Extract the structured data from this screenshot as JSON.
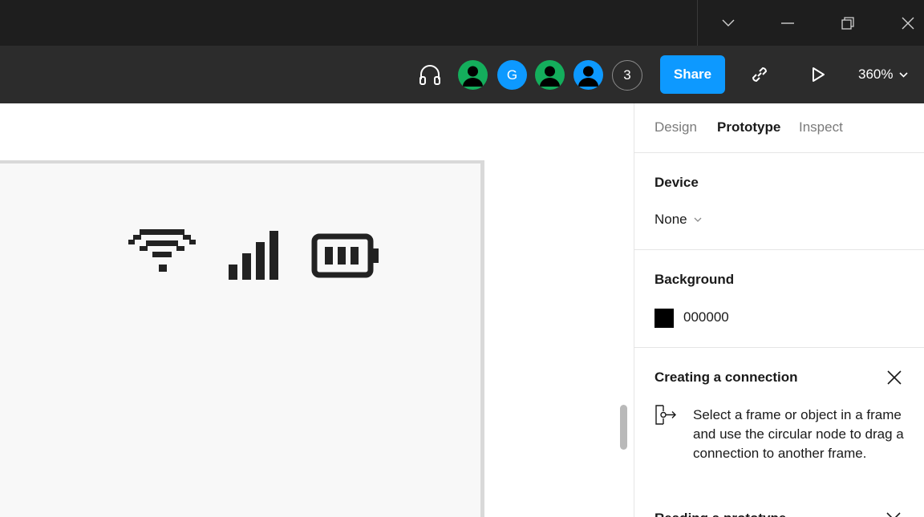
{
  "titlebar": {
    "icons": [
      "chevron-down-icon",
      "minimize-icon",
      "restore-icon",
      "close-icon"
    ]
  },
  "toolbar": {
    "avatar_letter": "G",
    "extra_users_count": "3",
    "share_label": "Share",
    "zoom_label": "360%",
    "colors": {
      "share": "#0d99ff",
      "avatar_green": "#14ae5c",
      "avatar_blue": "#0d99ff"
    }
  },
  "panel": {
    "tabs": [
      {
        "label": "Design",
        "active": false
      },
      {
        "label": "Prototype",
        "active": true
      },
      {
        "label": "Inspect",
        "active": false
      }
    ],
    "device": {
      "title": "Device",
      "value": "None"
    },
    "background": {
      "title": "Background",
      "color_hex": "000000",
      "color": "#000000"
    },
    "connection": {
      "title": "Creating a connection",
      "description": "Select a frame or object in a frame and use the circular node to drag a connection to another frame."
    },
    "next_section_title": "Reading a prototype"
  }
}
